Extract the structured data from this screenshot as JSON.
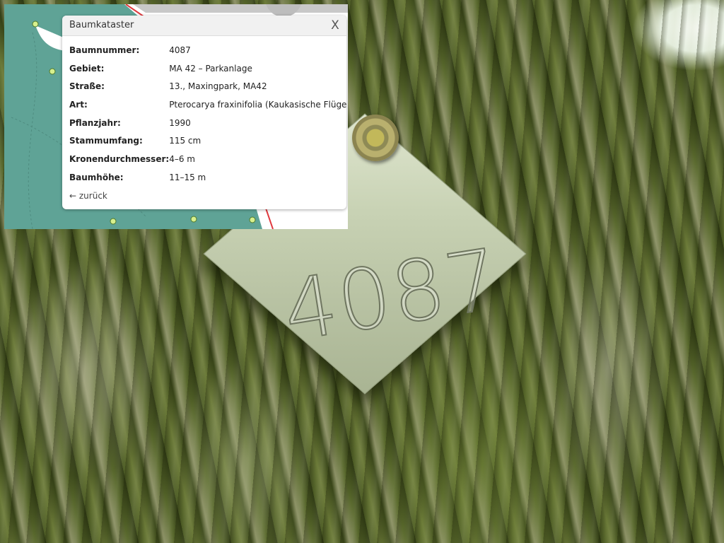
{
  "popup": {
    "title": "Baumkataster",
    "close_label": "X",
    "rows": [
      {
        "label": "Baumnummer:",
        "value": "4087"
      },
      {
        "label": "Gebiet:",
        "value": "MA 42 – Parkanlage"
      },
      {
        "label": "Straße:",
        "value": "13., Maxingpark, MA42"
      },
      {
        "label": "Art:",
        "value": "Pterocarya fraxinifolia (Kaukasische Flügelnuss)"
      },
      {
        "label": "Pflanzjahr:",
        "value": "1990"
      },
      {
        "label": "Stammumfang:",
        "value": "115 cm"
      },
      {
        "label": "Kronendurchmesser:",
        "value": "4–6 m"
      },
      {
        "label": "Baumhöhe:",
        "value": "11–15 m"
      }
    ],
    "back_label": "← zurück"
  },
  "photo": {
    "plate_number": "4087"
  },
  "colors": {
    "map_background": "#5fa396",
    "marker": "#d7f08e",
    "road_red": "#e0393e"
  },
  "icons": {
    "close": "close-icon",
    "back_arrow": "arrow-left-icon"
  }
}
